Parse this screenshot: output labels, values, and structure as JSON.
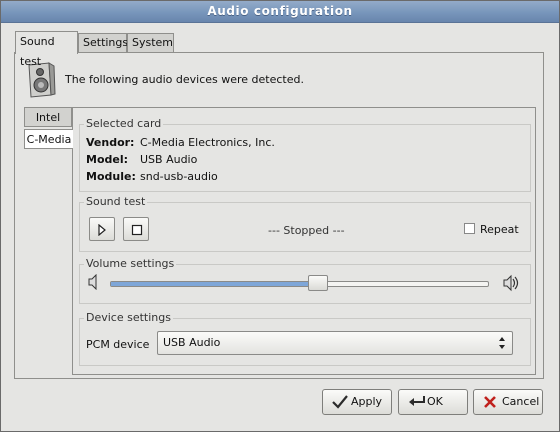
{
  "window": {
    "title": "Audio configuration"
  },
  "tabs": [
    {
      "label": "Sound test",
      "active": true
    },
    {
      "label": "Settings",
      "active": false
    },
    {
      "label": "System",
      "active": false
    }
  ],
  "intro": {
    "text": "The following audio devices were detected."
  },
  "cards": [
    {
      "label": "Intel",
      "selected": false
    },
    {
      "label": "C-Media",
      "selected": true
    }
  ],
  "selected_card": {
    "title": "Selected card",
    "vendor_label": "Vendor:",
    "vendor": "C-Media Electronics, Inc.",
    "model_label": "Model:",
    "model": "USB Audio",
    "module_label": "Module:",
    "module": "snd-usb-audio"
  },
  "sound_test": {
    "title": "Sound test",
    "status": "--- Stopped ---",
    "repeat_label": "Repeat",
    "repeat_checked": false,
    "play_icon": "play-icon",
    "stop_icon": "stop-icon"
  },
  "volume": {
    "title": "Volume settings",
    "level_percent": 55,
    "low_icon": "volume-low-icon",
    "high_icon": "volume-high-icon"
  },
  "device": {
    "title": "Device settings",
    "pcm_label": "PCM device",
    "pcm_value": "USB Audio"
  },
  "buttons": {
    "apply": "Apply",
    "ok": "OK",
    "cancel": "Cancel"
  },
  "colors": {
    "titlebar": "#7896bb",
    "slider_fill": "#7ea6d8",
    "cancel_x": "#c0211d",
    "apply_check": "#2b2b2b"
  }
}
